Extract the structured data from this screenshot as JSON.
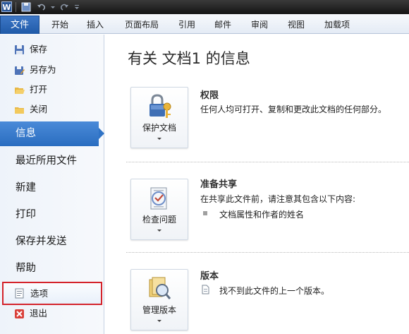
{
  "titlebar": {
    "logo_letter": "W"
  },
  "ribbon": {
    "file_tab": "文件",
    "tabs": [
      "开始",
      "插入",
      "页面布局",
      "引用",
      "邮件",
      "审阅",
      "视图",
      "加载项"
    ]
  },
  "nav": {
    "top_items": [
      {
        "label": "保存",
        "icon": "save-icon"
      },
      {
        "label": "另存为",
        "icon": "save-as-icon"
      },
      {
        "label": "打开",
        "icon": "open-folder-icon"
      },
      {
        "label": "关闭",
        "icon": "close-folder-icon"
      }
    ],
    "info": "信息",
    "recent": "最近所用文件",
    "new": "新建",
    "print": "打印",
    "save_send": "保存并发送",
    "help": "帮助",
    "options": {
      "label": "选项",
      "icon": "options-icon"
    },
    "exit": {
      "label": "退出",
      "icon": "exit-icon"
    }
  },
  "main": {
    "title": "有关 文档1 的信息",
    "sections": [
      {
        "button_label": "保护文档",
        "button_icon": "lock-keys-icon",
        "title": "权限",
        "description": "任何人均可打开、复制和更改此文档的任何部分。"
      },
      {
        "button_label": "检查问题",
        "button_icon": "checklist-icon",
        "title": "准备共享",
        "description": "在共享此文件前，请注意其包含以下内容:",
        "bullets": [
          "文档属性和作者的姓名"
        ]
      },
      {
        "button_label": "管理版本",
        "button_icon": "document-search-icon",
        "title": "版本",
        "description": "找不到此文件的上一个版本。"
      }
    ]
  },
  "colors": {
    "file_tab": "#2b64b4",
    "selected_nav": "#2f73c6",
    "highlight_box": "#d4232b"
  }
}
